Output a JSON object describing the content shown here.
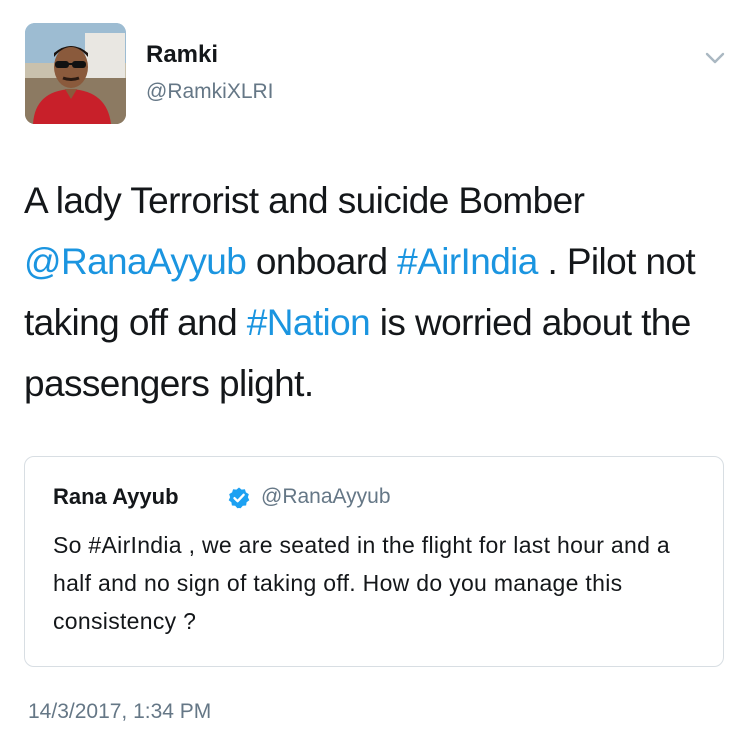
{
  "tweet": {
    "author": {
      "name": "Ramki",
      "handle": "@RamkiXLRI",
      "avatar_icon": "profile-photo"
    },
    "menu_icon": "chevron-down-icon",
    "text": {
      "part1": "A lady Terrorist and suicide Bomber ",
      "mention": "@RanaAyyub",
      "part2": " onboard ",
      "hashtag1": "#AirIndia",
      "part3": " . Pilot not taking off and ",
      "hashtag2": "#Nation",
      "part4": " is worried about the passengers plight."
    },
    "link_color": "#1b95e0",
    "timestamp": "14/3/2017, 1:34 PM"
  },
  "quoted_tweet": {
    "name": "Rana Ayyub",
    "verified": true,
    "verified_icon": "verified-badge-icon",
    "verified_color": "#1da1f2",
    "handle": "@RanaAyyub",
    "text": "So #AirIndia , we are seated in the flight for last hour and a half and no sign of taking off. How do you manage this consistency ?"
  }
}
